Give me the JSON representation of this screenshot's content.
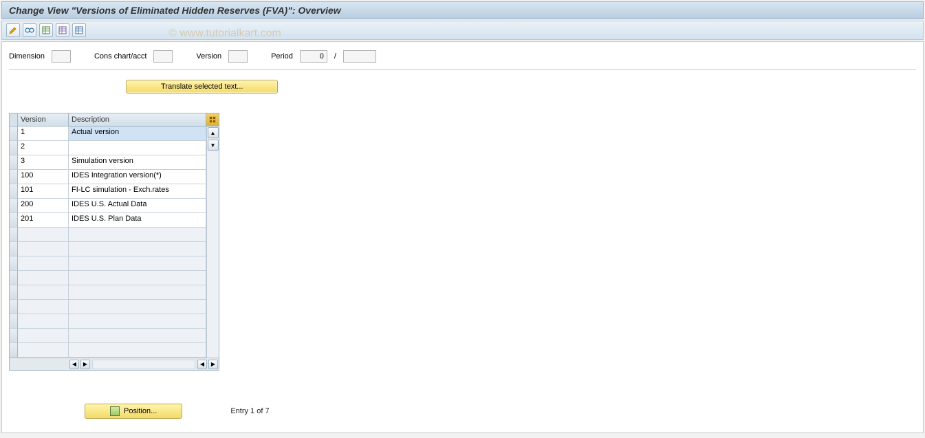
{
  "title": "Change View \"Versions of Eliminated Hidden Reserves (FVA)\": Overview",
  "watermark": "© www.tutorialkart.com",
  "toolbar": {
    "icons": [
      "pencil-icon",
      "glasses-icon",
      "table-icon",
      "table-save-icon",
      "table-settings-icon"
    ]
  },
  "fields": {
    "dimension_label": "Dimension",
    "dimension_value": "",
    "cons_chart_label": "Cons chart/acct",
    "cons_chart_value": "",
    "version_label": "Version",
    "version_value": "",
    "period_label": "Period",
    "period_value1": "0",
    "period_sep": "/",
    "period_value2": ""
  },
  "buttons": {
    "translate": "Translate selected text...",
    "position": "Position..."
  },
  "table": {
    "col_version": "Version",
    "col_description": "Description",
    "rows": [
      {
        "version": "1",
        "description": "Actual version",
        "selected": true
      },
      {
        "version": "2",
        "description": ""
      },
      {
        "version": "3",
        "description": "Simulation version"
      },
      {
        "version": "100",
        "description": "IDES Integration version(*)"
      },
      {
        "version": "101",
        "description": "FI-LC simulation - Exch.rates"
      },
      {
        "version": "200",
        "description": "IDES U.S. Actual Data"
      },
      {
        "version": "201",
        "description": "IDES U.S. Plan Data"
      }
    ],
    "empty_rows": 9
  },
  "footer": {
    "entry_text": "Entry 1 of 7"
  }
}
